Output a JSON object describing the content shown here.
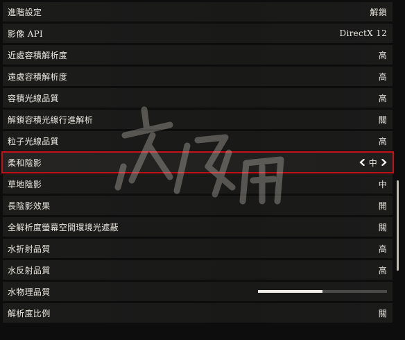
{
  "settings": {
    "rows": [
      {
        "label": "進階設定",
        "value": "解鎖"
      },
      {
        "label": "影像 API",
        "value": "DirectX 12"
      },
      {
        "label": "近處容積解析度",
        "value": "高"
      },
      {
        "label": "遠處容積解析度",
        "value": "高"
      },
      {
        "label": "容積光線品質",
        "value": "高"
      },
      {
        "label": "解鎖容積光線行進解析",
        "value": "關"
      },
      {
        "label": "粒子光線品質",
        "value": "高"
      },
      {
        "label": "柔和陰影",
        "value": "中"
      },
      {
        "label": "草地陰影",
        "value": "中"
      },
      {
        "label": "長陰影效果",
        "value": "開"
      },
      {
        "label": "全解析度螢幕空間環境光遮蔽",
        "value": "關"
      },
      {
        "label": "水折射品質",
        "value": "高"
      },
      {
        "label": "水反射品質",
        "value": "高"
      },
      {
        "label": "水物理品質",
        "slider_level": 0.5
      },
      {
        "label": "解析度比例",
        "value": "關"
      }
    ],
    "selected_index": 7
  },
  "colors": {
    "selection_border": "#c4121a",
    "row_bg": "#1c1c1b",
    "text": "#ece9e2",
    "slider_fill": "#f1eee8",
    "slider_track": "#4a4a48"
  },
  "icons": {
    "prev": "chevron-left-icon",
    "next": "chevron-right-icon"
  }
}
